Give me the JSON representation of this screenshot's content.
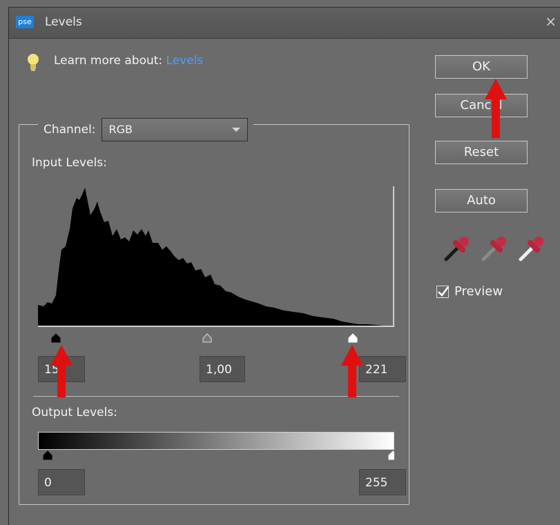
{
  "window": {
    "title": "Levels",
    "app_icon_label": "pse",
    "close_glyph": "×"
  },
  "tip": {
    "prefix": "Learn more about: ",
    "link": "Levels"
  },
  "channel": {
    "label": "Channel:",
    "value": "RGB"
  },
  "input_levels": {
    "label": "Input Levels:",
    "black": "15",
    "gamma": "1,00",
    "white": "221"
  },
  "output_levels": {
    "label": "Output Levels:",
    "black": "0",
    "white": "255"
  },
  "buttons": {
    "ok": "OK",
    "cancel": "Cancel",
    "reset": "Reset",
    "auto": "Auto"
  },
  "preview": {
    "label": "Preview",
    "checked": true
  },
  "colors": {
    "accent_link": "#4ea0f0",
    "arrow": "#e01010",
    "background": "#6b6b6b"
  }
}
